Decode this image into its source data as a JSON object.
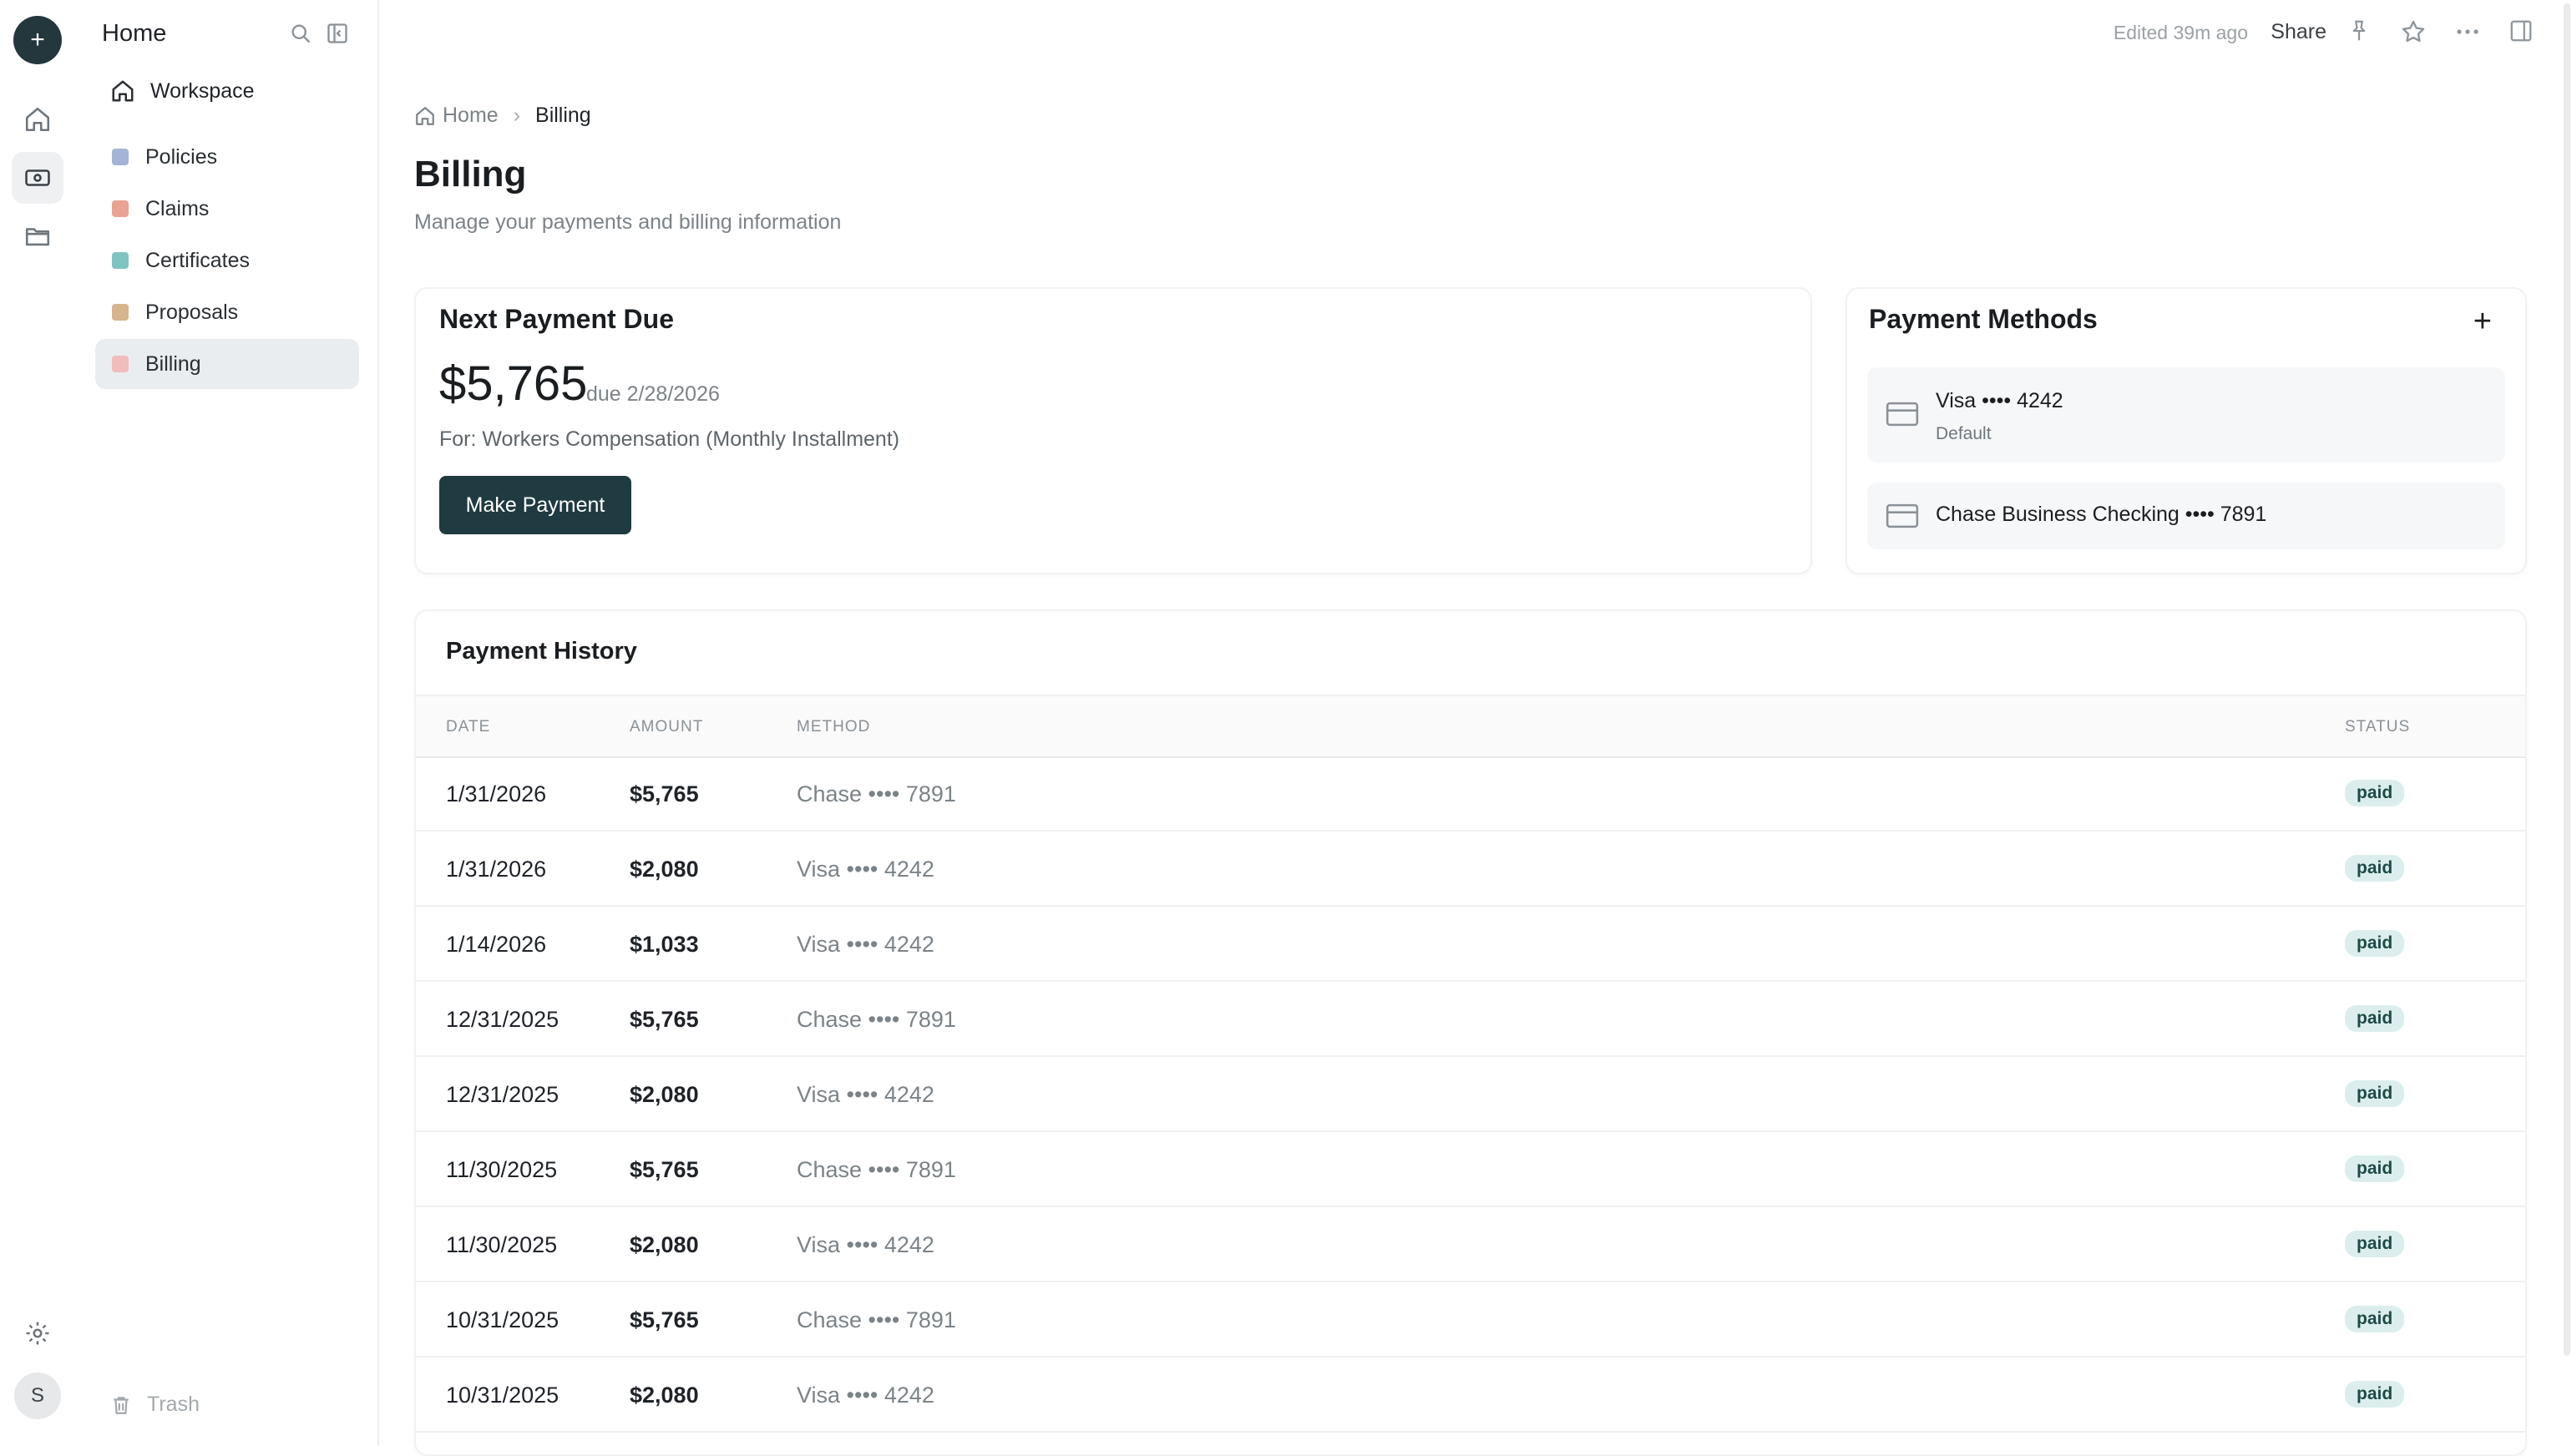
{
  "rail": {
    "new_icon": "plus-icon",
    "items": [
      "home-icon",
      "billing-icon",
      "folder-icon"
    ],
    "settings_icon": "gear-icon",
    "avatar_initial": "S"
  },
  "sidebar": {
    "title": "Home",
    "workspace": "Workspace",
    "items": [
      {
        "label": "Policies",
        "color": "#a5b4d6"
      },
      {
        "label": "Claims",
        "color": "#e8a394"
      },
      {
        "label": "Certificates",
        "color": "#7fc4c1"
      },
      {
        "label": "Proposals",
        "color": "#d6b48e"
      },
      {
        "label": "Billing",
        "color": "#f0bcbc"
      }
    ],
    "trash": "Trash"
  },
  "topbar": {
    "edited": "Edited 39m ago",
    "share": "Share"
  },
  "breadcrumb": {
    "home": "Home",
    "current": "Billing"
  },
  "page": {
    "title": "Billing",
    "subtitle": "Manage your payments and billing information"
  },
  "next_payment": {
    "title": "Next Payment Due",
    "amount": "$5,765",
    "due": "due 2/28/2026",
    "for": "For: Workers Compensation (Monthly Installment)",
    "button": "Make Payment"
  },
  "payment_methods": {
    "title": "Payment Methods",
    "items": [
      {
        "name": "Visa •••• 4242",
        "sub": "Default"
      },
      {
        "name": "Chase Business Checking •••• 7891",
        "sub": ""
      }
    ]
  },
  "history": {
    "title": "Payment History",
    "columns": {
      "date": "DATE",
      "amount": "AMOUNT",
      "method": "METHOD",
      "status": "STATUS"
    },
    "rows": [
      {
        "date": "1/31/2026",
        "amount": "$5,765",
        "method": "Chase •••• 7891",
        "status": "paid"
      },
      {
        "date": "1/31/2026",
        "amount": "$2,080",
        "method": "Visa •••• 4242",
        "status": "paid"
      },
      {
        "date": "1/14/2026",
        "amount": "$1,033",
        "method": "Visa •••• 4242",
        "status": "paid"
      },
      {
        "date": "12/31/2025",
        "amount": "$5,765",
        "method": "Chase •••• 7891",
        "status": "paid"
      },
      {
        "date": "12/31/2025",
        "amount": "$2,080",
        "method": "Visa •••• 4242",
        "status": "paid"
      },
      {
        "date": "11/30/2025",
        "amount": "$5,765",
        "method": "Chase •••• 7891",
        "status": "paid"
      },
      {
        "date": "11/30/2025",
        "amount": "$2,080",
        "method": "Visa •••• 4242",
        "status": "paid"
      },
      {
        "date": "10/31/2025",
        "amount": "$5,765",
        "method": "Chase •••• 7891",
        "status": "paid"
      },
      {
        "date": "10/31/2025",
        "amount": "$2,080",
        "method": "Visa •••• 4242",
        "status": "paid"
      }
    ]
  }
}
